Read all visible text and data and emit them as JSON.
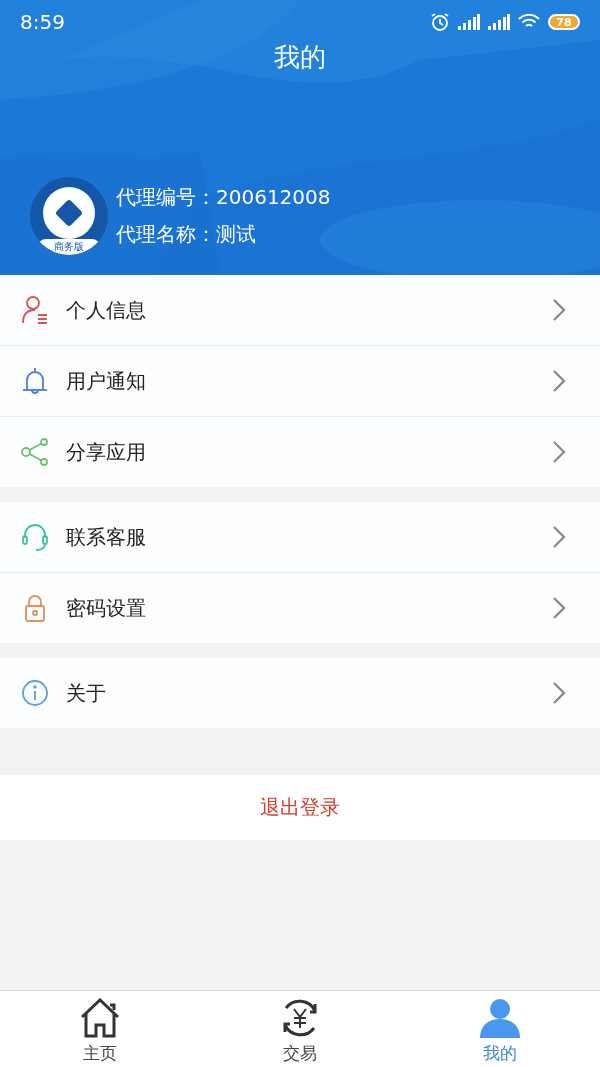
{
  "status_bar": {
    "time": "8:59",
    "battery": "78"
  },
  "header": {
    "title": "我的",
    "avatar_badge": "商务版",
    "agent_number": "代理编号：200612008",
    "agent_name": "代理名称：测试"
  },
  "menu_groups": [
    [
      {
        "kind": "person",
        "label": "个人信息"
      },
      {
        "kind": "bell",
        "label": "用户通知"
      },
      {
        "kind": "share",
        "label": "分享应用"
      }
    ],
    [
      {
        "kind": "headset",
        "label": "联系客服"
      },
      {
        "kind": "lock",
        "label": "密码设置"
      }
    ],
    [
      {
        "kind": "info",
        "label": "关于"
      }
    ]
  ],
  "logout": "退出登录",
  "tab_bar": [
    {
      "kind": "home",
      "label": "主页",
      "selected": false
    },
    {
      "kind": "trade",
      "label": "交易",
      "selected": false
    },
    {
      "kind": "profile",
      "label": "我的",
      "selected": true
    }
  ]
}
